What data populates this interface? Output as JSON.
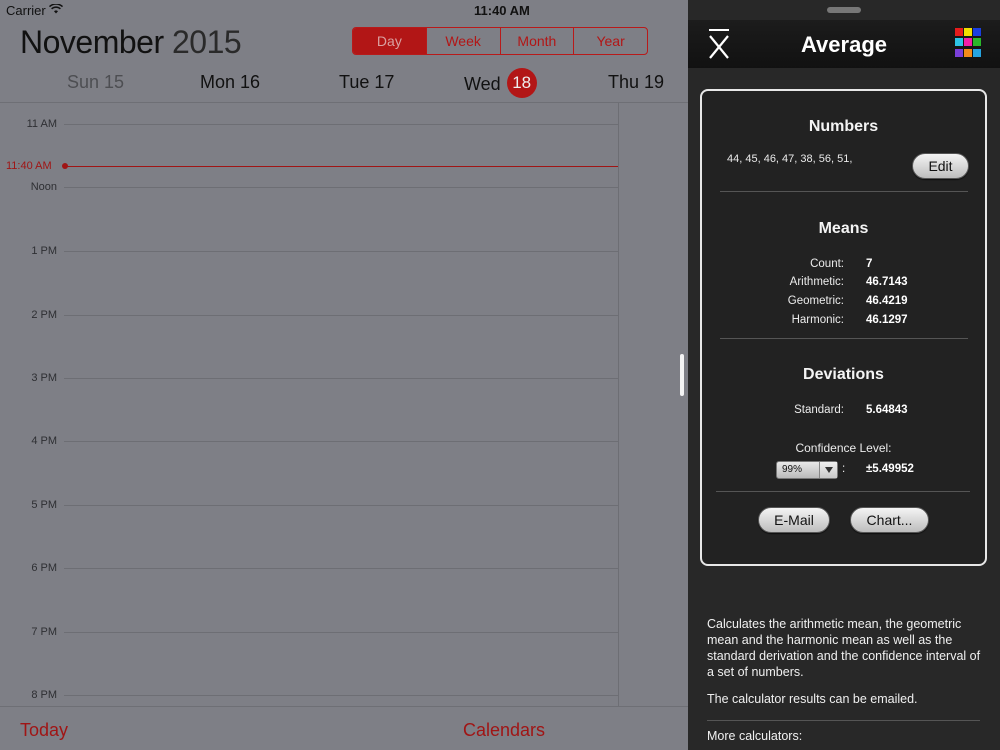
{
  "status_bar": {
    "carrier": "Carrier",
    "time": "11:40 AM"
  },
  "calendar": {
    "month": "November",
    "year": "2015",
    "views": [
      {
        "label": "Day",
        "active": true
      },
      {
        "label": "Week",
        "active": false
      },
      {
        "label": "Month",
        "active": false
      },
      {
        "label": "Year",
        "active": false
      }
    ],
    "days": [
      {
        "label": "Sun 15"
      },
      {
        "label": "Mon 16"
      },
      {
        "label": "Tue 17"
      },
      {
        "label": "Wed",
        "badge": "18"
      },
      {
        "label": "Thu 19"
      }
    ],
    "hours": [
      "11 AM",
      "Noon",
      "1 PM",
      "2 PM",
      "3 PM",
      "4 PM",
      "5 PM",
      "6 PM",
      "7 PM",
      "8 PM"
    ],
    "now_label": "11:40 AM",
    "today": "Today",
    "calendars": "Calendars",
    "accent_color": "#b21616"
  },
  "app": {
    "title": "Average",
    "numbers_title": "Numbers",
    "numbers_list": "44, 45, 46, 47, 38, 56, 51,",
    "edit_label": "Edit",
    "means_title": "Means",
    "means": [
      {
        "label": "Count:",
        "value": "7"
      },
      {
        "label": "Arithmetic:",
        "value": "46.7143"
      },
      {
        "label": "Geometric:",
        "value": "46.4219"
      },
      {
        "label": "Harmonic:",
        "value": "46.1297"
      }
    ],
    "deviations_title": "Deviations",
    "standard_label": "Standard:",
    "standard_value": "5.64843",
    "confidence_label": "Confidence Level:",
    "confidence_selected": "99%",
    "confidence_colon": ":",
    "confidence_value": "±5.49952",
    "email_label": "E-Mail",
    "chart_label": "Chart...",
    "description": "Calculates the arithmetic mean, the geometric mean and the harmonic mean as well as the standard derivation and the confidence interval of a set of numbers.",
    "emailed_note": "The calculator results can be emailed.",
    "more_calculators": "More calculators:",
    "icons": {
      "header_left": "x-bar-icon",
      "header_right": "color-grid-icon"
    },
    "color_grid": [
      "#e61c1c",
      "#f2e000",
      "#1a3fe0",
      "#2ec4e6",
      "#f21fa8",
      "#2ab82a",
      "#7a3fd8",
      "#f28a1a",
      "#25a4e0"
    ]
  }
}
